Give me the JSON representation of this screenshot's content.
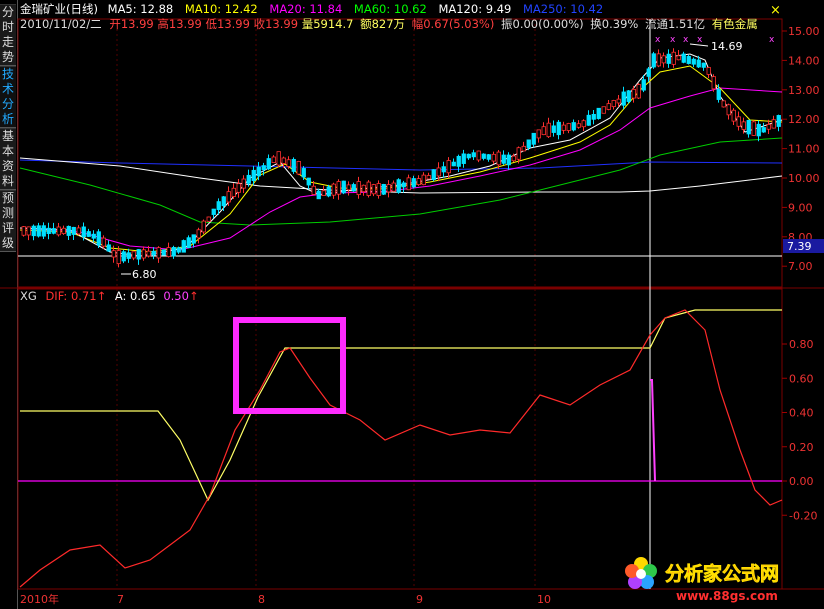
{
  "sidebar": {
    "tabs": [
      {
        "label": "分时走势",
        "active": false
      },
      {
        "label": "技术分析",
        "active": true
      },
      {
        "label": "基本资料",
        "active": false
      },
      {
        "label": "预测评级",
        "active": false
      }
    ]
  },
  "header": {
    "stock": "金瑞矿业(日线)",
    "ma": [
      {
        "text": "MA5: 12.88",
        "color": "#ffffff"
      },
      {
        "text": "MA10: 12.42",
        "color": "#ffff00"
      },
      {
        "text": "MA20: 11.84",
        "color": "#ff00ff"
      },
      {
        "text": "MA60: 10.62",
        "color": "#00ff00"
      },
      {
        "text": "MA120: 9.49",
        "color": "#ffffff"
      },
      {
        "text": "MA250: 10.42",
        "color": "#2244ff"
      }
    ],
    "date": "2010/11/02/二",
    "quote": [
      {
        "text": "开13.99",
        "color": "#ff4040"
      },
      {
        "text": "高13.99",
        "color": "#ff4040"
      },
      {
        "text": "低13.99",
        "color": "#ff4040"
      },
      {
        "text": "收13.99",
        "color": "#ff4040"
      },
      {
        "text": "量5914.7",
        "color": "#ffff60"
      },
      {
        "text": "额827万",
        "color": "#ffff60"
      },
      {
        "text": "幅0.67(5.03%)",
        "color": "#ff4040"
      },
      {
        "text": "振0.00(0.00%)",
        "color": "#dddddd"
      },
      {
        "text": "换0.39%",
        "color": "#dddddd"
      },
      {
        "text": "流通1.51亿",
        "color": "#dddddd"
      },
      {
        "text": "有色金属",
        "color": "#ffff60"
      }
    ]
  },
  "price_axis": {
    "ticks": [
      "15.00",
      "14.00",
      "13.00",
      "12.00",
      "11.00",
      "10.00",
      "9.00",
      "8.00",
      "7.00"
    ],
    "current_price_tag": "7.39"
  },
  "annotations": {
    "high_label": "14.69",
    "low_label": "6.80"
  },
  "indicator": {
    "name": "XG",
    "dif": "DIF: 0.71",
    "a": "A: 0.65",
    "b": "0.50",
    "ticks": [
      "0.80",
      "0.60",
      "0.40",
      "0.20",
      "0.00",
      "-0.20"
    ]
  },
  "time_axis": {
    "labels": [
      "2010年",
      "7",
      "8",
      "9",
      "10"
    ]
  },
  "watermark": {
    "cn": "分析家公式网",
    "url": "www.88gs.com"
  },
  "window": {
    "close_glyph": "×"
  },
  "chart_data": [
    {
      "type": "candlestick",
      "title": "金瑞矿业(日线)",
      "ylim": [
        6.7,
        15.4
      ],
      "series": [
        {
          "name": "MA5"
        },
        {
          "name": "MA10"
        },
        {
          "name": "MA20"
        },
        {
          "name": "MA60"
        },
        {
          "name": "MA120"
        },
        {
          "name": "MA250"
        }
      ],
      "annotations": [
        {
          "text": "14.69"
        },
        {
          "text": "6.80"
        }
      ]
    },
    {
      "type": "line",
      "title": "XG",
      "ylim": [
        -0.3,
        0.9
      ],
      "series": [
        {
          "name": "DIF"
        },
        {
          "name": "A"
        }
      ]
    }
  ]
}
